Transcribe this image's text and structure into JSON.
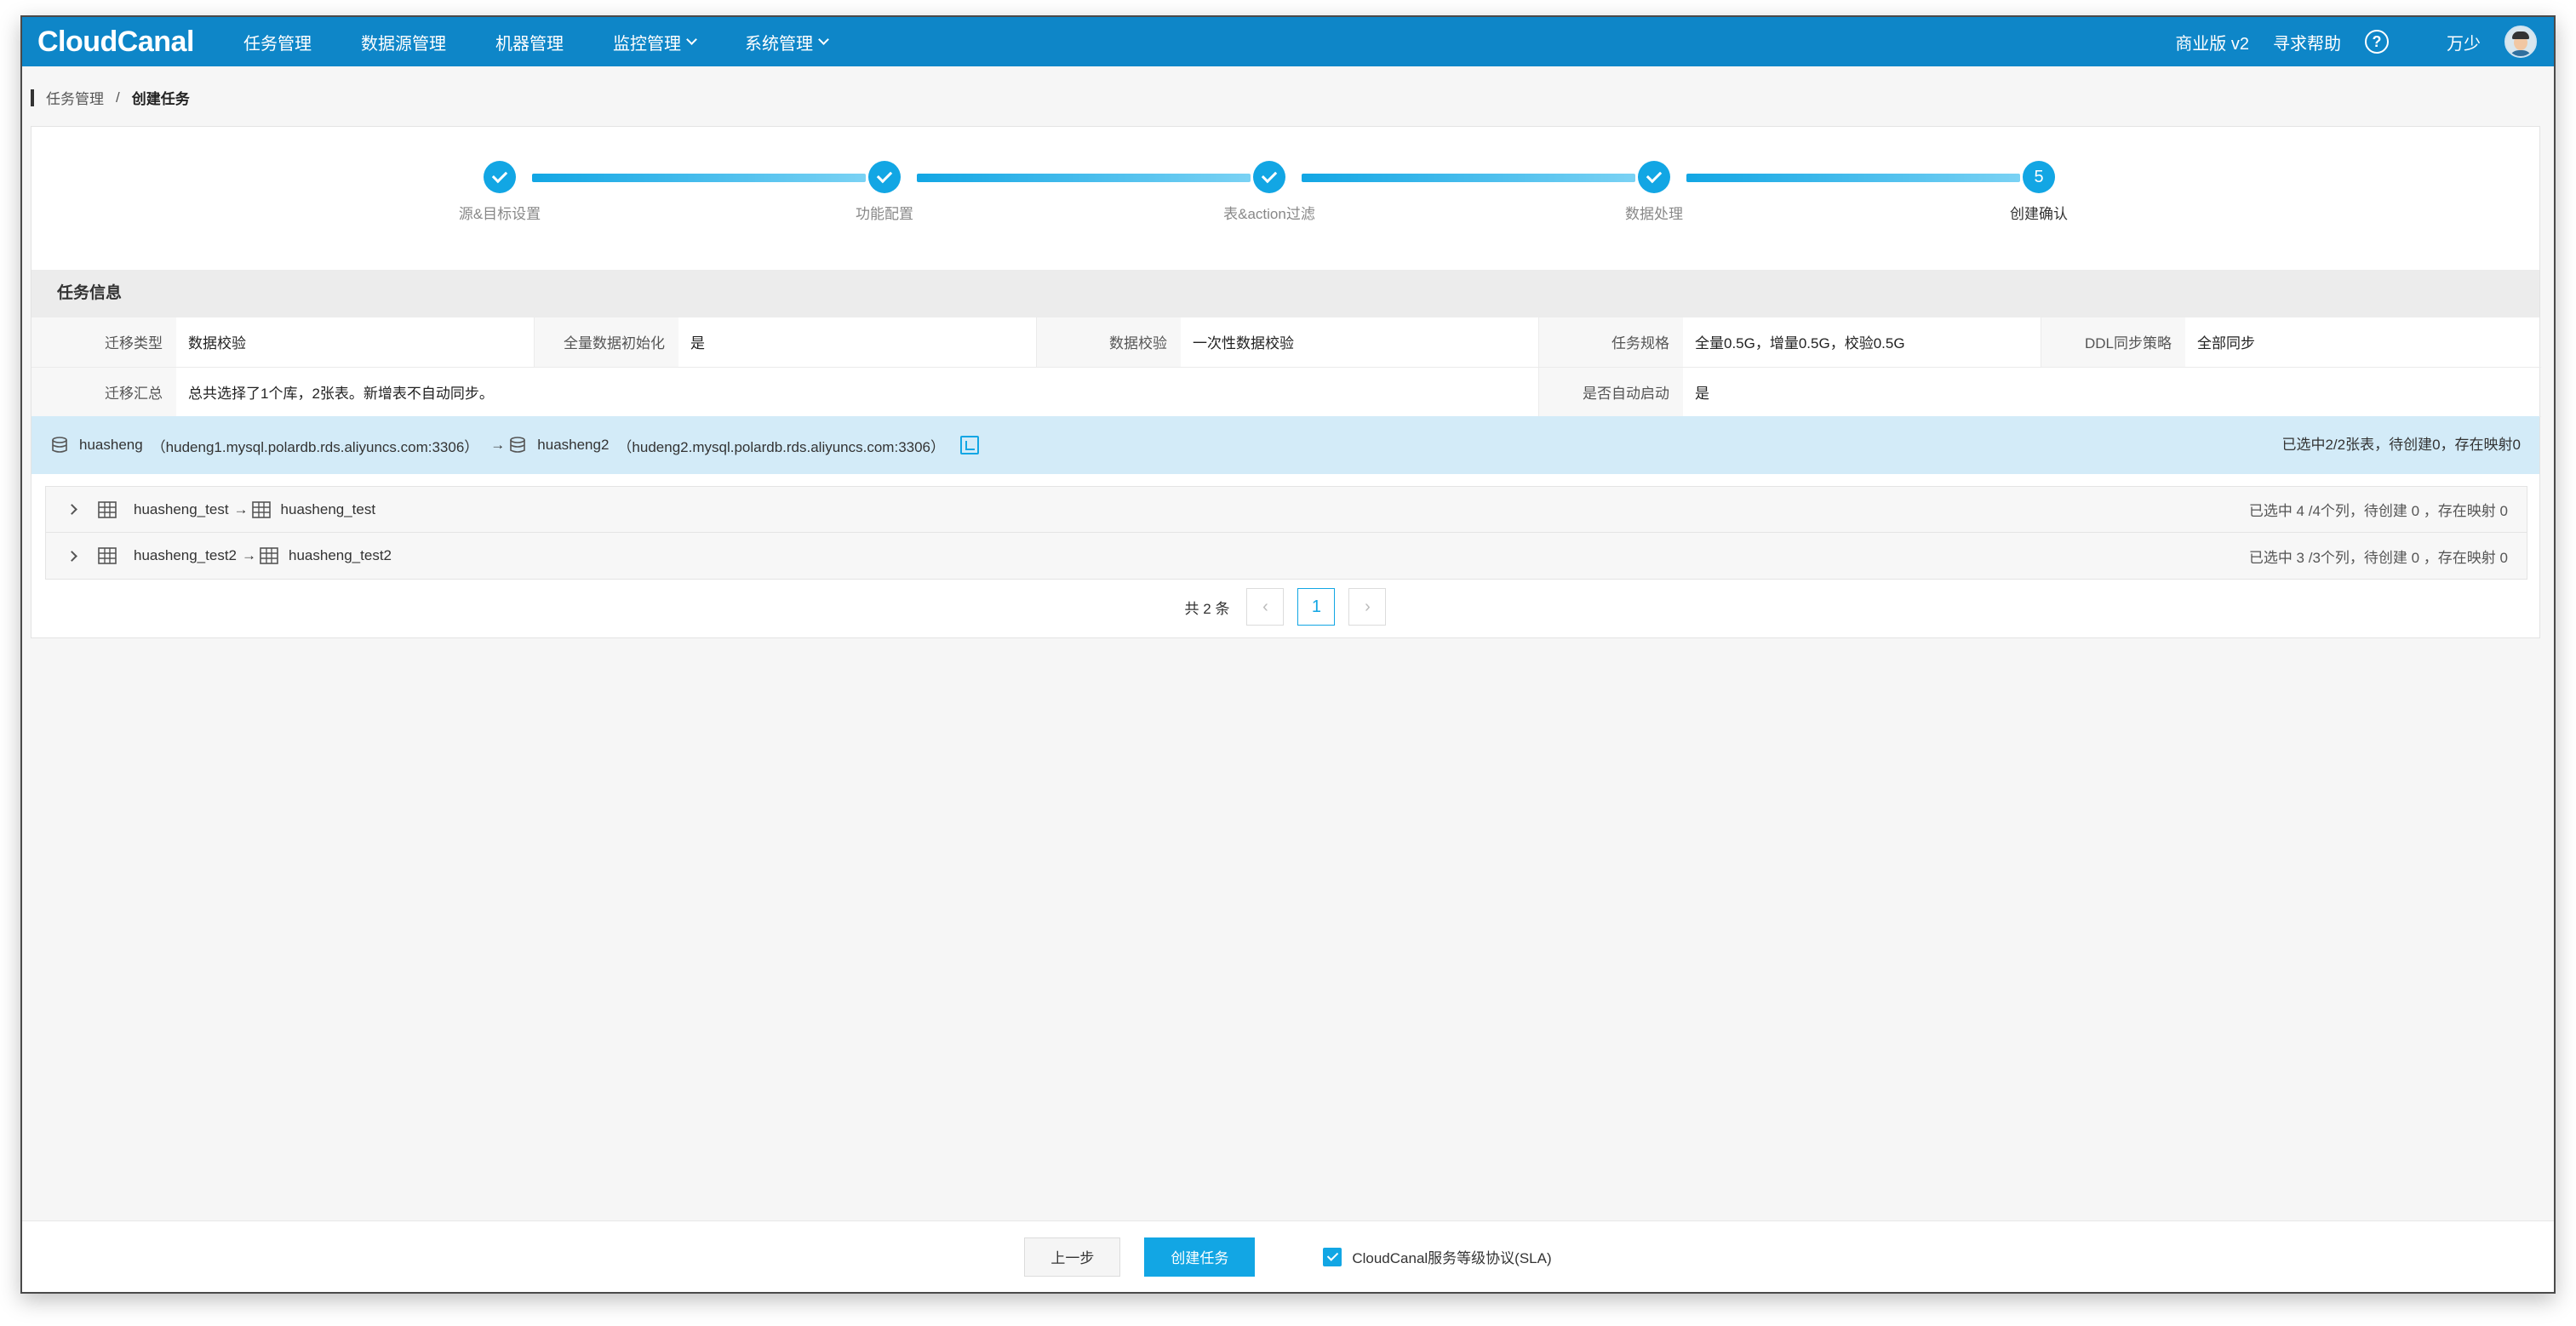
{
  "app": {
    "logo": "CloudCanal"
  },
  "nav": {
    "items": [
      {
        "label": "任务管理",
        "dropdown": false
      },
      {
        "label": "数据源管理",
        "dropdown": false
      },
      {
        "label": "机器管理",
        "dropdown": false
      },
      {
        "label": "监控管理",
        "dropdown": true
      },
      {
        "label": "系统管理",
        "dropdown": true
      }
    ],
    "edition": "商业版 v2",
    "help": "寻求帮助",
    "help_icon": "?",
    "user": "万少"
  },
  "breadcrumb": {
    "parent": "任务管理",
    "separator": "/",
    "current": "创建任务"
  },
  "steps": [
    {
      "label": "源&目标设置",
      "done": true
    },
    {
      "label": "功能配置",
      "done": true
    },
    {
      "label": "表&action过滤",
      "done": true
    },
    {
      "label": "数据处理",
      "done": true
    },
    {
      "label": "创建确认",
      "number": "5",
      "done": false
    }
  ],
  "task_info": {
    "title": "任务信息",
    "row1": [
      {
        "key": "迁移类型",
        "value": "数据校验"
      },
      {
        "key": "全量数据初始化",
        "value": "是"
      },
      {
        "key": "数据校验",
        "value": "一次性数据校验"
      },
      {
        "key": "任务规格",
        "value": "全量0.5G，增量0.5G，校验0.5G"
      },
      {
        "key": "DDL同步策略",
        "value": "全部同步"
      }
    ],
    "row2": [
      {
        "key": "迁移汇总",
        "value": "总共选择了1个库，2张表。新增表不自动同步。"
      },
      {
        "key": "是否自动启动",
        "value": "是"
      }
    ]
  },
  "mapping": {
    "source_db": "huasheng",
    "source_host": "（hudeng1.mysql.polardb.rds.aliyuncs.com:3306）",
    "arrow": "→",
    "target_db": "huasheng2",
    "target_host": "（hudeng2.mysql.polardb.rds.aliyuncs.com:3306）",
    "summary": "已选中2/2张表，待创建0，存在映射0"
  },
  "tables": [
    {
      "source": "huasheng_test",
      "arrow": "→",
      "target": "huasheng_test",
      "summary": "已选中 4 /4个列，待创建 0 ，存在映射 0"
    },
    {
      "source": "huasheng_test2",
      "arrow": "→",
      "target": "huasheng_test2",
      "summary": "已选中 3 /3个列，待创建 0 ，存在映射 0"
    }
  ],
  "pagination": {
    "total": "共 2 条",
    "prev": "‹",
    "current": "1",
    "next": "›"
  },
  "footer": {
    "prev_label": "上一步",
    "create_label": "创建任务",
    "sla_label": "CloudCanal服务等级协议(SLA)",
    "sla_checked": true
  },
  "colors": {
    "nav": "#0e86c8",
    "accent": "#12a6e4",
    "mapping_bg": "#d3ebf8"
  }
}
